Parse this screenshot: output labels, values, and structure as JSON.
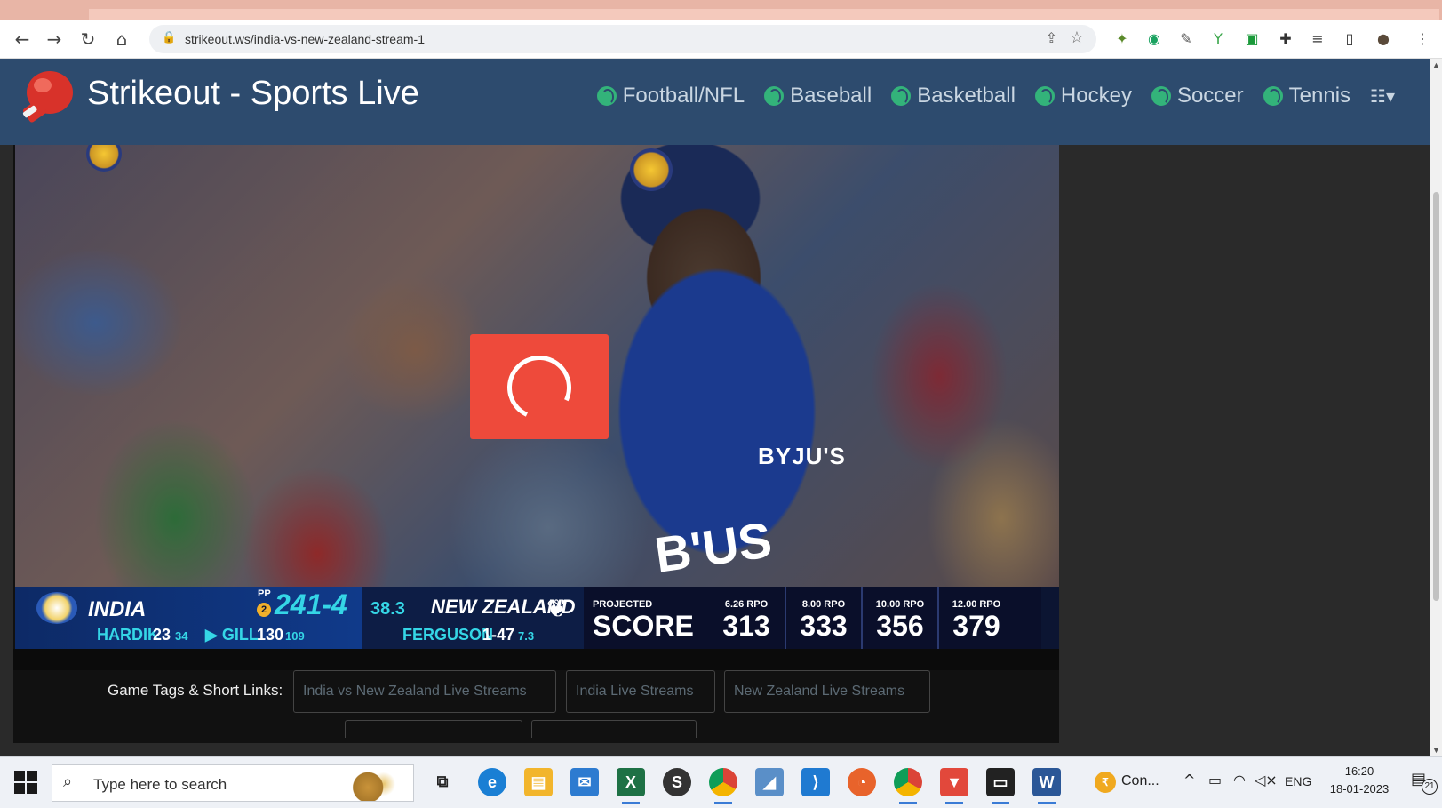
{
  "browser": {
    "url": "strikeout.ws/india-vs-new-zealand-stream-1",
    "icons": [
      "back-icon",
      "forward-icon",
      "reload-icon",
      "home-icon",
      "lock-icon",
      "share-icon",
      "star-icon"
    ]
  },
  "site": {
    "title": "Strikeout - Sports Live",
    "menu": [
      {
        "label": "Football/NFL",
        "icon": "football-icon"
      },
      {
        "label": "Baseball",
        "icon": "baseball-icon"
      },
      {
        "label": "Basketball",
        "icon": "basketball-icon"
      },
      {
        "label": "Hockey",
        "icon": "hockey-icon"
      },
      {
        "label": "Soccer",
        "icon": "soccer-icon"
      },
      {
        "label": "Tennis",
        "icon": "tennis-icon"
      }
    ],
    "accent": "#e84c3d",
    "nav_bg": "#2d4b6e"
  },
  "video": {
    "jersey_text": "BYJU'S",
    "scoreboard": {
      "team1": "INDIA",
      "pp_label": "PP",
      "pp_number": "2",
      "score": "241-4",
      "overs": "38.3",
      "team2": "NEW ZEALAND",
      "batter1_name": "HARDIK",
      "batter1_runs": "23",
      "batter1_balls": "34",
      "batter2_name": "▶ GILL",
      "batter2_runs": "130",
      "batter2_balls": "109",
      "bowler_name": "FERGUSON",
      "bowler_figures": "1-47",
      "bowler_overs": "7.3",
      "projected_label": "PROJECTED",
      "projected_title": "SCORE",
      "projections": [
        {
          "rpo": "6.26 RPO",
          "score": "313"
        },
        {
          "rpo": "8.00 RPO",
          "score": "333"
        },
        {
          "rpo": "10.00 RPO",
          "score": "356"
        },
        {
          "rpo": "12.00 RPO",
          "score": "379"
        }
      ]
    }
  },
  "tags": {
    "label": "Game Tags & Short Links:",
    "items": [
      "India vs New Zealand Live Streams",
      "India Live Streams",
      "New Zealand Live Streams"
    ]
  },
  "taskbar": {
    "search_placeholder": "Type here to search",
    "apps": [
      "task-view",
      "edge",
      "file-explorer",
      "mail",
      "excel",
      "app",
      "chrome",
      "app",
      "vscode",
      "firefox",
      "chrome",
      "brave",
      "terminal",
      "word"
    ],
    "tray_app_label": "Con...",
    "language": "ENG",
    "time": "16:20",
    "date": "18-01-2023",
    "notifications": "21"
  }
}
